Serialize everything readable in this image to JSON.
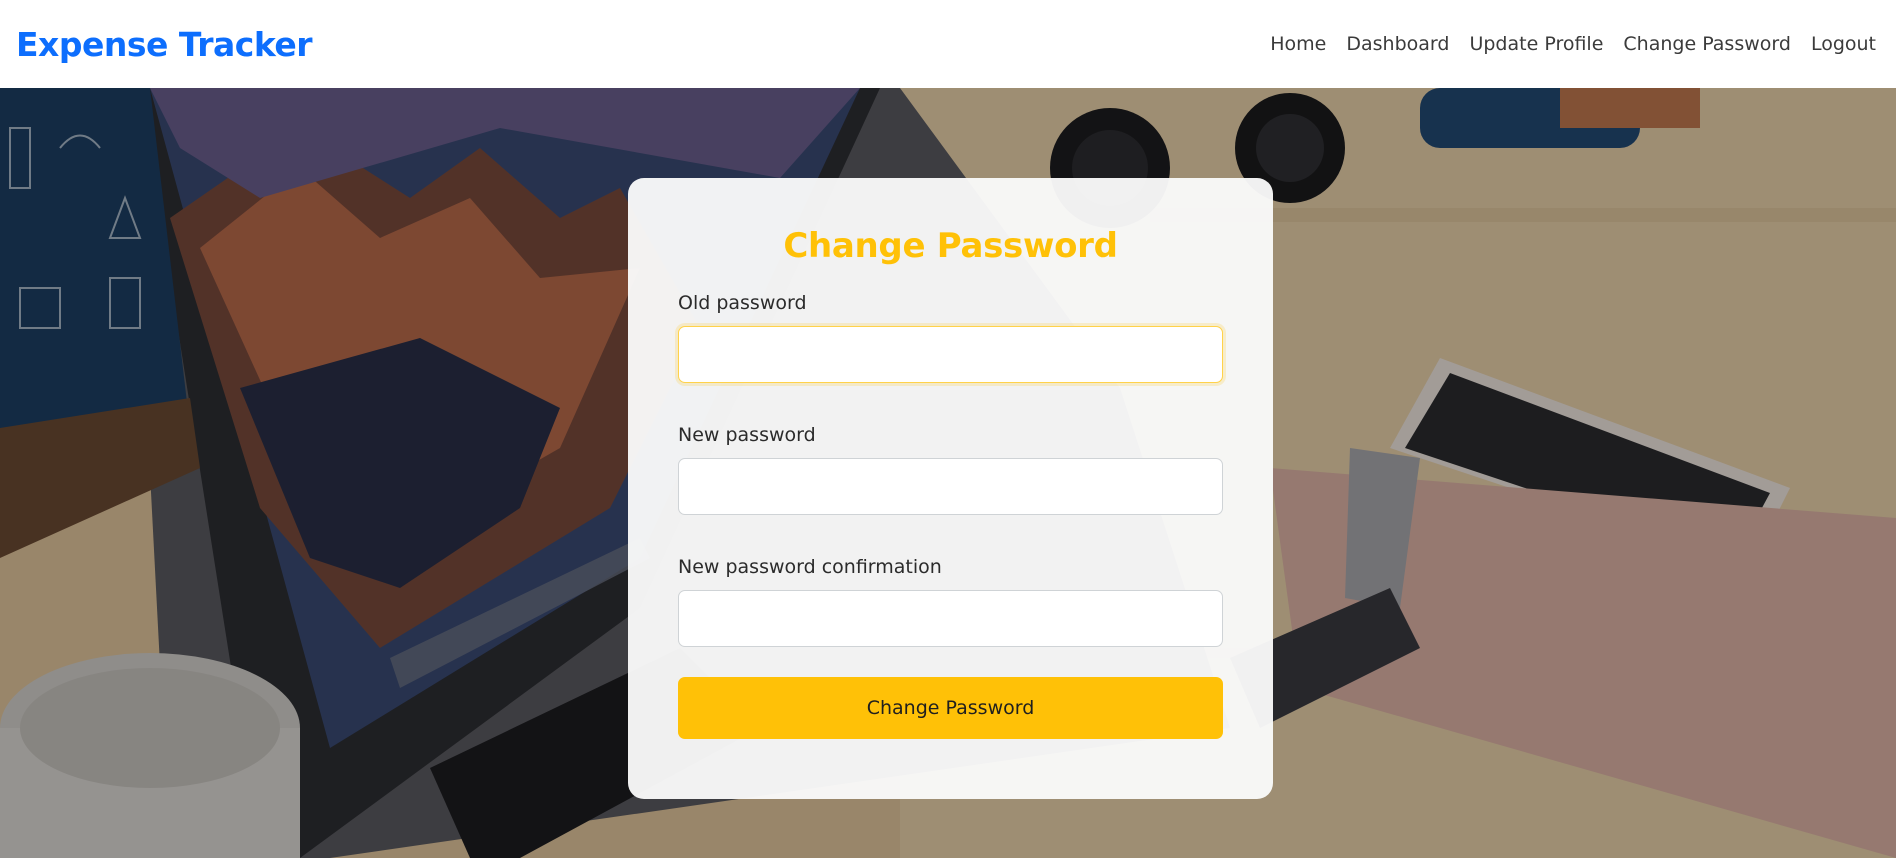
{
  "navbar": {
    "brand": "Expense Tracker",
    "links": [
      "Home",
      "Dashboard",
      "Update Profile",
      "Change Password",
      "Logout"
    ]
  },
  "form": {
    "title": "Change Password",
    "fields": [
      {
        "label": "Old password",
        "value": ""
      },
      {
        "label": "New password",
        "value": ""
      },
      {
        "label": "New password confirmation",
        "value": ""
      }
    ],
    "submit_label": "Change Password"
  },
  "colors": {
    "brand": "#0d6efd",
    "accent": "#ffc107"
  }
}
